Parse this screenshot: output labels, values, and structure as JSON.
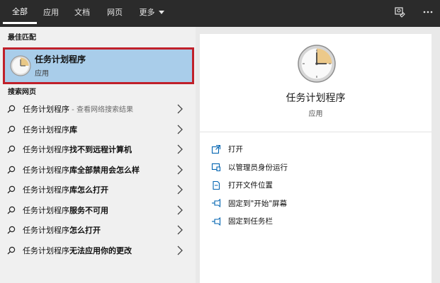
{
  "tabs": [
    {
      "label": "全部",
      "active": true
    },
    {
      "label": "应用",
      "active": false
    },
    {
      "label": "文档",
      "active": false
    },
    {
      "label": "网页",
      "active": false
    },
    {
      "label": "更多",
      "active": false
    }
  ],
  "top_icons": [
    "feedback-icon",
    "more-options-icon"
  ],
  "best_match": {
    "section_label": "最佳匹配",
    "title": "任务计划程序",
    "subtitle": "应用",
    "icon": "clock-icon"
  },
  "web_search": {
    "section_label": "搜索网页",
    "results": [
      {
        "query": "任务计划程序",
        "suffix": "",
        "hint": " - 查看网络搜索结果"
      },
      {
        "query": "任务计划程序",
        "suffix": "库",
        "hint": ""
      },
      {
        "query": "任务计划程序",
        "suffix": "找不到远程计算机",
        "hint": ""
      },
      {
        "query": "任务计划程序",
        "suffix": "库全部禁用会怎么样",
        "hint": ""
      },
      {
        "query": "任务计划程序",
        "suffix": "库怎么打开",
        "hint": ""
      },
      {
        "query": "任务计划程序",
        "suffix": "服务不可用",
        "hint": ""
      },
      {
        "query": "任务计划程序",
        "suffix": "怎么打开",
        "hint": ""
      },
      {
        "query": "任务计划程序",
        "suffix": "无法应用你的更改",
        "hint": ""
      }
    ]
  },
  "detail": {
    "title": "任务计划程序",
    "type": "应用",
    "actions": [
      {
        "label": "打开",
        "icon": "open-icon"
      },
      {
        "label": "以管理员身份运行",
        "icon": "run-as-admin-icon"
      },
      {
        "label": "打开文件位置",
        "icon": "file-location-icon"
      },
      {
        "label": "固定到\"开始\"屏幕",
        "icon": "pin-icon"
      },
      {
        "label": "固定到任务栏",
        "icon": "pin-icon"
      }
    ]
  },
  "colors": {
    "topbar": "#2b2b2b",
    "selected_bg": "#a9cdea",
    "highlight_border": "#c0202a",
    "accent": "#0063b1"
  }
}
